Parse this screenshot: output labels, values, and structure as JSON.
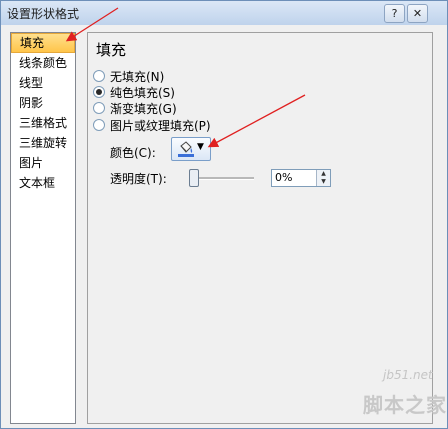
{
  "window": {
    "title": "设置形状格式",
    "help_label": "?",
    "close_label": "✕"
  },
  "sidebar": {
    "items": [
      {
        "label": "填充",
        "selected": true
      },
      {
        "label": "线条颜色"
      },
      {
        "label": "线型"
      },
      {
        "label": "阴影"
      },
      {
        "label": "三维格式"
      },
      {
        "label": "三维旋转"
      },
      {
        "label": "图片"
      },
      {
        "label": "文本框"
      }
    ]
  },
  "main": {
    "heading": "填充",
    "options": [
      {
        "label": "无填充(N)",
        "checked": false
      },
      {
        "label": "纯色填充(S)",
        "checked": true
      },
      {
        "label": "渐变填充(G)",
        "checked": false
      },
      {
        "label": "图片或纹理填充(P)",
        "checked": false
      }
    ],
    "color_label": "颜色(C):",
    "color_button_icon": "paint-bucket-icon",
    "transparency_label": "透明度(T):",
    "transparency_value": "0%",
    "transparency_level": 0
  },
  "annotation_color": "#e02020",
  "watermark": {
    "site": "jb51.net",
    "name": "脚本之家"
  }
}
